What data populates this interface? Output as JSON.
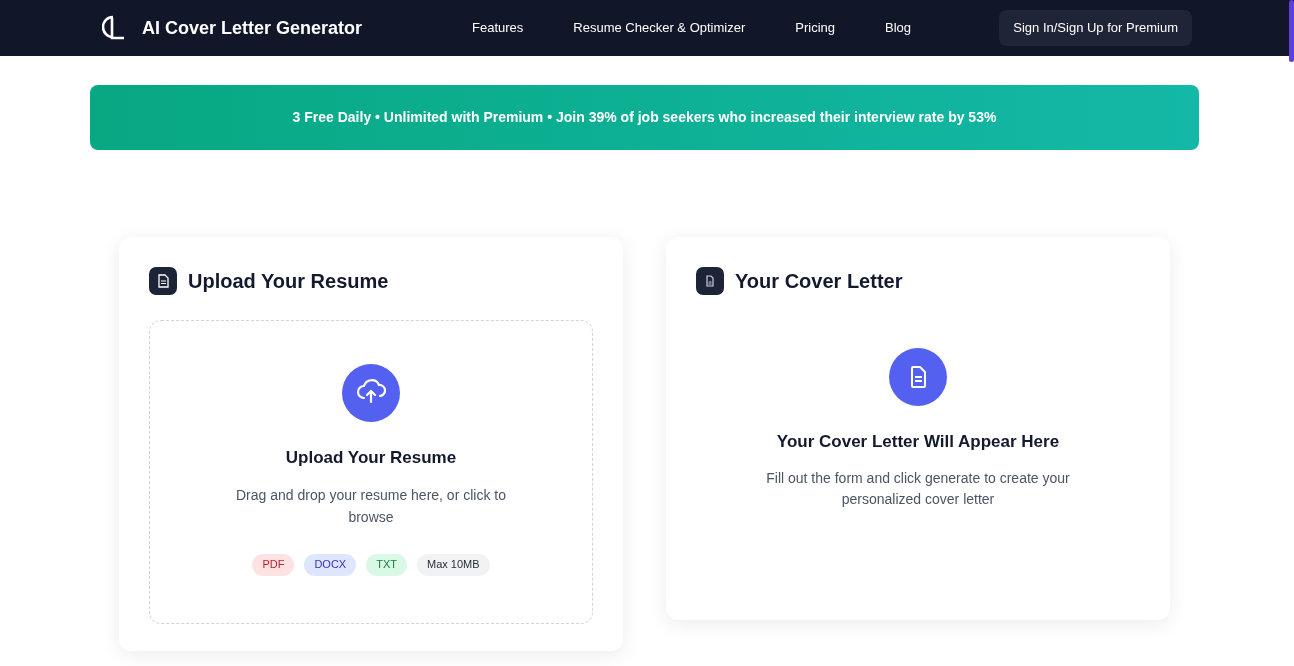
{
  "header": {
    "brand": "AI Cover Letter Generator",
    "nav": [
      "Features",
      "Resume Checker & Optimizer",
      "Pricing",
      "Blog"
    ],
    "cta": "Sign In/Sign Up for Premium"
  },
  "banner": "3 Free Daily • Unlimited with Premium • Join 39% of job seekers who increased their interview rate by 53%",
  "upload_card": {
    "title": "Upload Your Resume",
    "dropzone": {
      "title": "Upload Your Resume",
      "hint": "Drag and drop your resume here, or click to browse",
      "tags": [
        {
          "label": "PDF",
          "kind": "pdf"
        },
        {
          "label": "DOCX",
          "kind": "docx"
        },
        {
          "label": "TXT",
          "kind": "txt"
        },
        {
          "label": "Max 10MB",
          "kind": "limit"
        }
      ]
    }
  },
  "letter_card": {
    "title": "Your Cover Letter",
    "empty_title": "Your Cover Letter Will Appear Here",
    "empty_hint": "Fill out the form and click generate to create your personalized cover letter"
  }
}
